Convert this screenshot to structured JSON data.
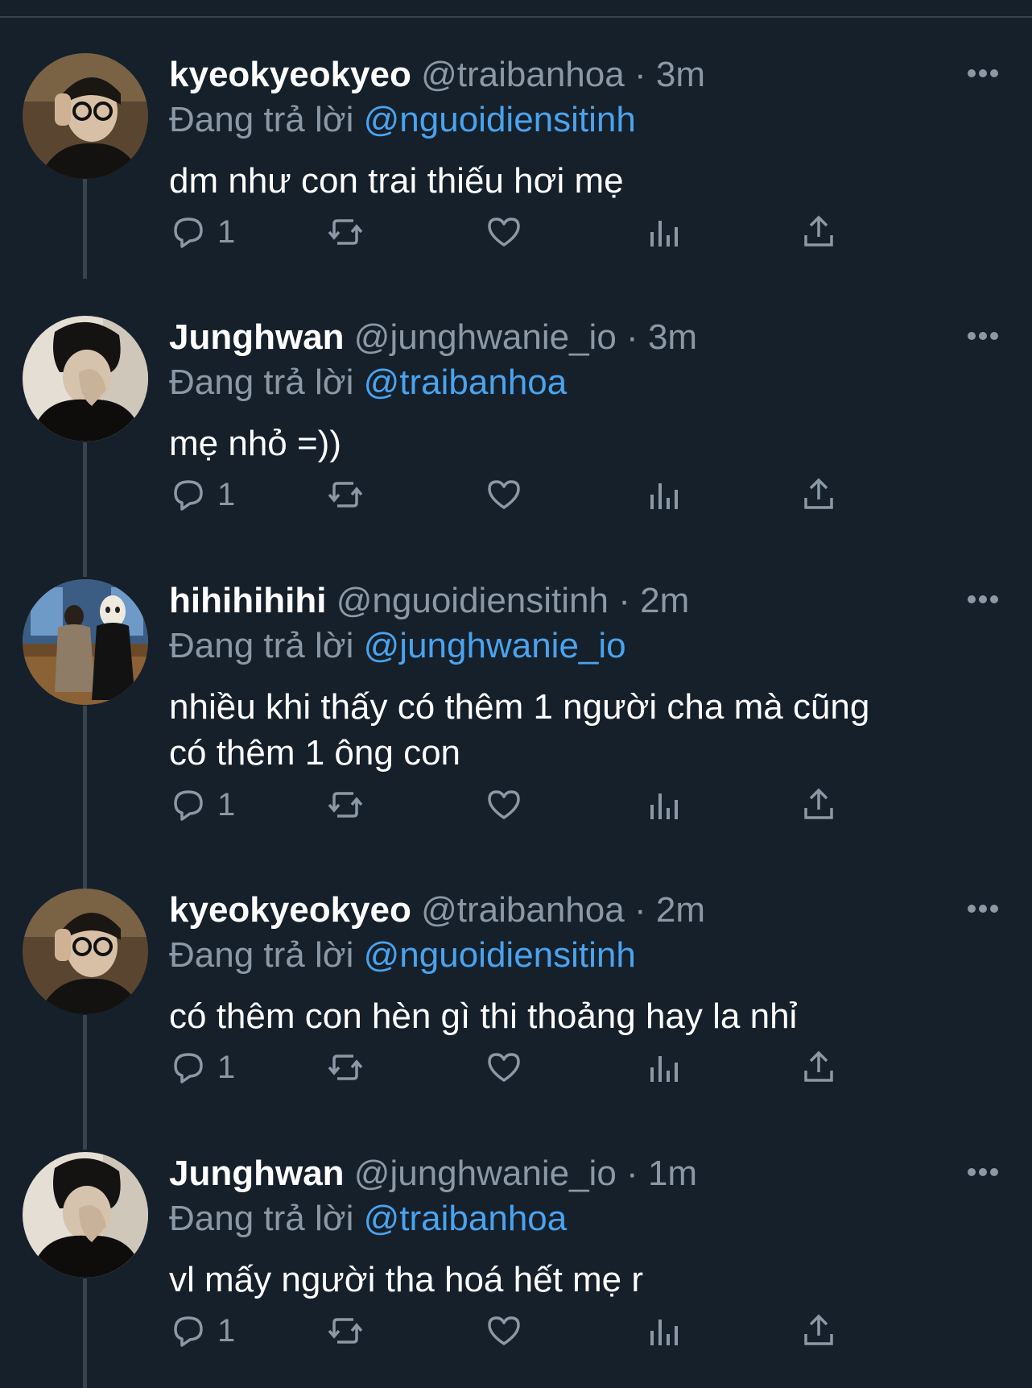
{
  "theme": {
    "background": "#15202b",
    "muted": "#8b98a5",
    "link": "#4aa3ee",
    "divider": "#38444d"
  },
  "tweets": [
    {
      "name": "kyeokyeokyeo",
      "handle": "@traibanhoa",
      "time": "3m",
      "replying_label": "Đang trả lời",
      "replying_to": "@nguoidiensitinh",
      "lines": [
        "dm như con trai thiếu hơi mẹ"
      ],
      "reply_count": "1",
      "avatar": "glasses-portrait"
    },
    {
      "name": "Junghwan",
      "handle": "@junghwanie_io",
      "time": "3m",
      "replying_label": "Đang trả lời",
      "replying_to": "@traibanhoa",
      "lines": [
        "mẹ nhỏ =))"
      ],
      "reply_count": "1",
      "avatar": "hand-portrait"
    },
    {
      "name": "hihihihihi",
      "handle": "@nguoidiensitinh",
      "time": "2m",
      "replying_label": "Đang trả lời",
      "replying_to": "@junghwanie_io",
      "lines": [
        "nhiều khi thấy có thêm 1 người cha mà cũng",
        "có thêm 1 ông con"
      ],
      "reply_count": "1",
      "avatar": "train-scene"
    },
    {
      "name": "kyeokyeokyeo",
      "handle": "@traibanhoa",
      "time": "2m",
      "replying_label": "Đang trả lời",
      "replying_to": "@nguoidiensitinh",
      "lines": [
        "có thêm con hèn gì thi thoảng hay la nhỉ"
      ],
      "reply_count": "1",
      "avatar": "glasses-portrait"
    },
    {
      "name": "Junghwan",
      "handle": "@junghwanie_io",
      "time": "1m",
      "replying_label": "Đang trả lời",
      "replying_to": "@traibanhoa",
      "lines": [
        "vl mấy người tha hoá hết mẹ r"
      ],
      "reply_count": "1",
      "avatar": "hand-portrait"
    }
  ],
  "actions": [
    "reply-icon",
    "retweet-icon",
    "like-icon",
    "views-icon",
    "share-icon"
  ],
  "separator": "·"
}
